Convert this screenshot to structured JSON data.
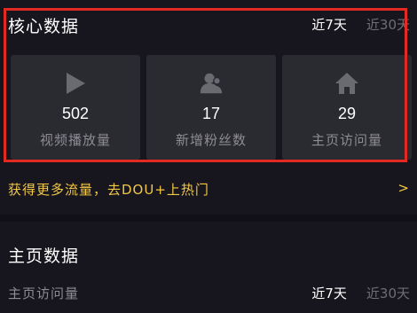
{
  "core": {
    "title": "核心数据",
    "range_tabs": [
      {
        "label": "近7天",
        "active": true
      },
      {
        "label": "近30天",
        "active": false
      }
    ],
    "cards": [
      {
        "icon": "play-icon",
        "value": "502",
        "label": "视频播放量"
      },
      {
        "icon": "fans-icon",
        "value": "17",
        "label": "新增粉丝数"
      },
      {
        "icon": "home-icon",
        "value": "29",
        "label": "主页访问量"
      }
    ]
  },
  "promo": {
    "text": "获得更多流量，去DOU+上热门",
    "arrow": ">"
  },
  "homepage": {
    "title": "主页数据",
    "metric_label": "主页访问量",
    "range_tabs": [
      {
        "label": "近7天",
        "active": true
      },
      {
        "label": "近30天",
        "active": false
      }
    ]
  },
  "colors": {
    "background": "#17161e",
    "card": "#2a2a31",
    "accent_yellow": "#f3c846",
    "highlight_red": "#e22a22",
    "muted_text": "#8d8c92"
  }
}
